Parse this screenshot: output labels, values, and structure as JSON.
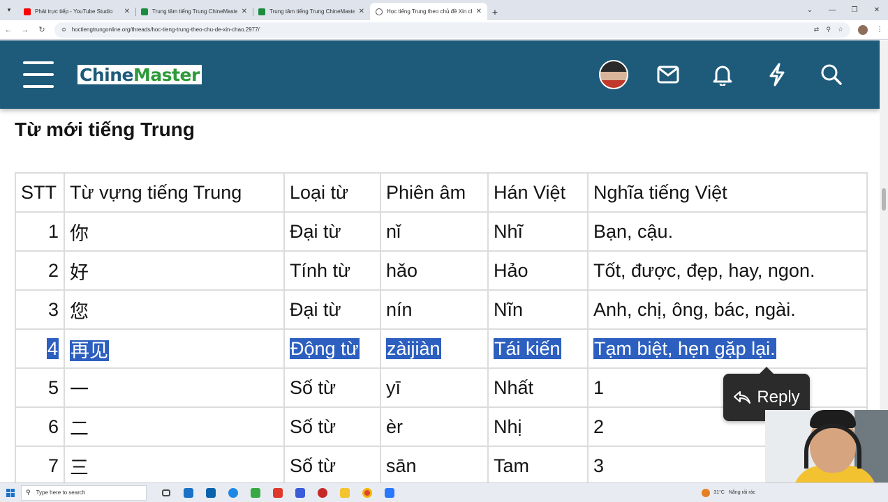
{
  "browser": {
    "tabs": [
      {
        "title": "Phát trực tiếp - YouTube Studio",
        "favicon": "youtube-icon",
        "active": false
      },
      {
        "title": "Trung tâm tiếng Trung ChineMaster",
        "favicon": "document-icon",
        "active": false
      },
      {
        "title": "Trung tâm tiếng Trung ChineMaster",
        "favicon": "document-icon",
        "active": false
      },
      {
        "title": "Học tiếng Trung theo chủ đề Xin chào",
        "favicon": "globe-icon",
        "active": true
      }
    ],
    "url": "hoctiengtrungonline.org/threads/hoc-tieng-trung-theo-chu-de-xin-chao.2977/"
  },
  "site": {
    "logo_part1": "Chine",
    "logo_part2": "Master",
    "colors": {
      "header_bg": "#1e5b7a",
      "logo_green": "#2e9a3a",
      "selection": "#2c5fbf"
    }
  },
  "content": {
    "section_title": "Từ mới tiếng Trung",
    "table": {
      "headers": [
        "STT",
        "Từ vựng tiếng Trung",
        "Loại từ",
        "Phiên âm",
        "Hán Việt",
        "Nghĩa tiếng Việt"
      ],
      "rows": [
        [
          "1",
          "你",
          "Đại từ",
          "nǐ",
          "Nhĩ",
          "Bạn, cậu."
        ],
        [
          "2",
          "好",
          "Tính từ",
          "hǎo",
          "Hảo",
          "Tốt, được, đẹp, hay, ngon."
        ],
        [
          "3",
          "您",
          "Đại từ",
          "nín",
          "Nĩn",
          "Anh, chị, ông, bác, ngài."
        ],
        [
          "4",
          "再见",
          "Động từ",
          "zàijiàn",
          "Tái kiến",
          "Tạm biệt, hẹn gặp lại."
        ],
        [
          "5",
          "一",
          "Số từ",
          "yī",
          "Nhất",
          "1"
        ],
        [
          "6",
          "二",
          "Số từ",
          "èr",
          "Nhị",
          "2"
        ],
        [
          "7",
          "三",
          "Số từ",
          "sān",
          "Tam",
          "3"
        ]
      ],
      "selected_row": 4
    },
    "reply_label": "Reply"
  },
  "taskbar": {
    "search_placeholder": "Type here to search",
    "weather_temp": "31°C",
    "weather_text": "Nắng rải rác"
  }
}
